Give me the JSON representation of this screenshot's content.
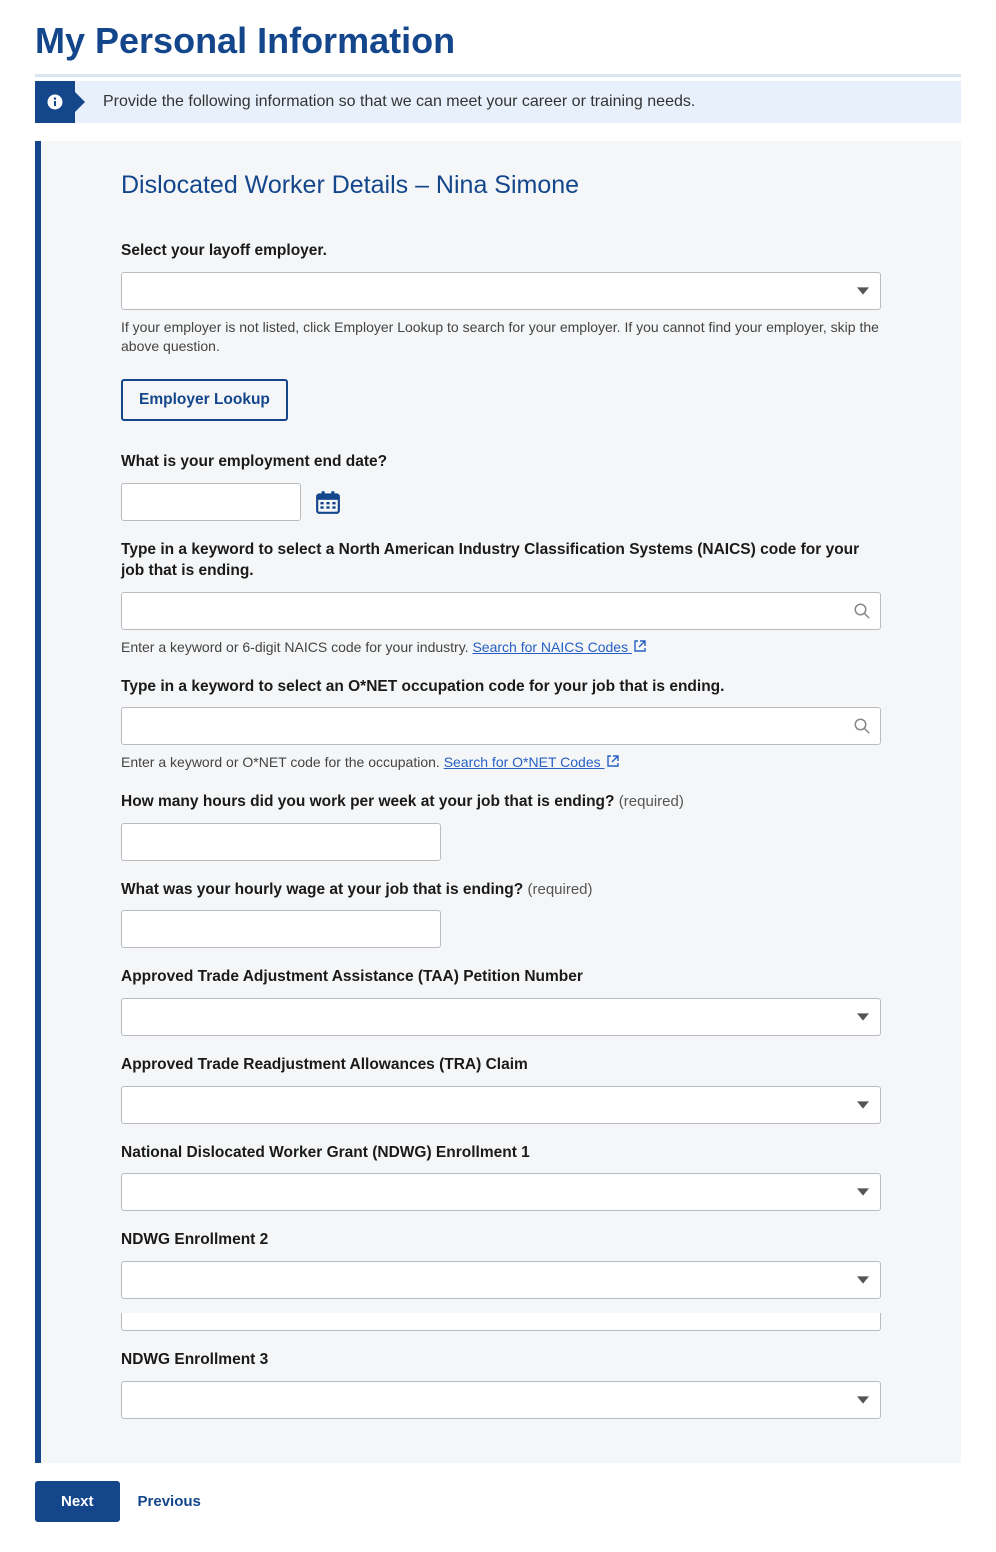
{
  "page": {
    "title": "My Personal Information",
    "banner_text": "Provide the following information so that we can meet your career or training needs."
  },
  "section": {
    "title": "Dislocated Worker Details – Nina Simone"
  },
  "employer": {
    "label": "Select your layoff employer.",
    "hint": "If your employer is not listed, click Employer Lookup to search for your employer. If you cannot find your employer, skip the above question.",
    "lookup_button": "Employer Lookup"
  },
  "end_date": {
    "label": "What is your employment end date?"
  },
  "naics": {
    "label": "Type in a keyword to select a North American Industry Classification Systems (NAICS) code for your job that is ending.",
    "hint_prefix": "Enter a keyword or 6-digit NAICS code for your industry. ",
    "link_text": "Search for NAICS Codes "
  },
  "onet": {
    "label": "Type in a keyword to select an O*NET occupation code for your job that is ending.",
    "hint_prefix": "Enter a keyword or O*NET code for the occupation. ",
    "link_text": "Search for O*NET Codes "
  },
  "hours": {
    "label": "How many hours did you work per week at your job that is ending? ",
    "required": "(required)"
  },
  "wage": {
    "label": "What was your hourly wage at your job that is ending? ",
    "required": "(required)"
  },
  "taa": {
    "label": "Approved Trade Adjustment Assistance (TAA) Petition Number"
  },
  "tra": {
    "label": "Approved Trade Readjustment Allowances (TRA) Claim"
  },
  "ndwg1": {
    "label": "National Dislocated Worker Grant (NDWG) Enrollment 1"
  },
  "ndwg2": {
    "label": "NDWG Enrollment 2"
  },
  "ndwg3": {
    "label": "NDWG Enrollment 3"
  },
  "actions": {
    "next": "Next",
    "previous": "Previous"
  }
}
